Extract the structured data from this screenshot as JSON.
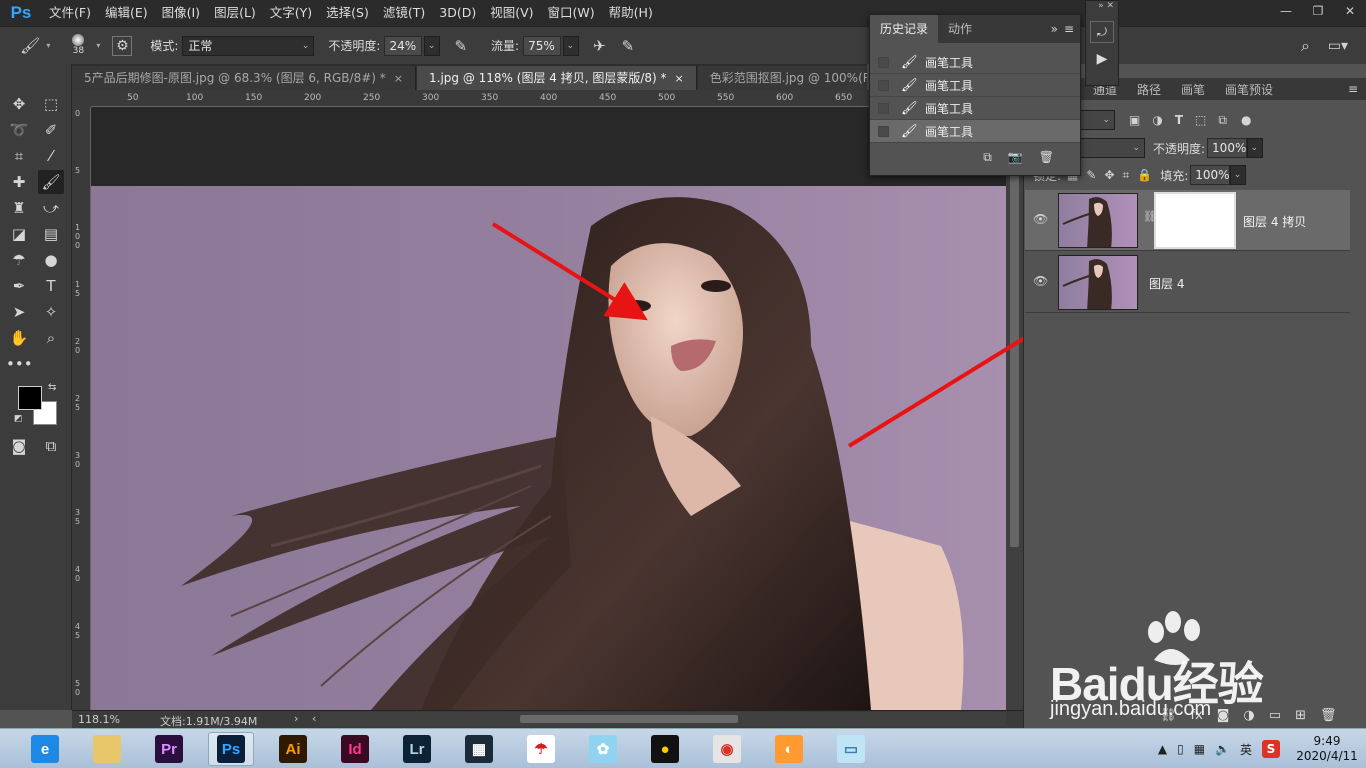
{
  "app": {
    "logo": "Ps"
  },
  "menu": {
    "items": [
      "文件(F)",
      "编辑(E)",
      "图像(I)",
      "图层(L)",
      "文字(Y)",
      "选择(S)",
      "滤镜(T)",
      "3D(D)",
      "视图(V)",
      "窗口(W)",
      "帮助(H)"
    ]
  },
  "options": {
    "brush_size": "38",
    "mode_label": "模式:",
    "mode_value": "正常",
    "opacity_label": "不透明度:",
    "opacity_value": "24%",
    "flow_label": "流量:",
    "flow_value": "75%"
  },
  "tabs": [
    {
      "label": "5产品后期修图-原图.jpg @ 68.3% (图层 6, RGB/8#) *",
      "close": "×"
    },
    {
      "label": "1.jpg @ 118% (图层 4 拷贝, 图层蒙版/8) *",
      "close": "×"
    },
    {
      "label": "色彩范围抠图.jpg @ 100%(RGB/8#)",
      "close": "×"
    }
  ],
  "ruler": {
    "top": [
      "50",
      "100",
      "150",
      "200",
      "250",
      "300",
      "350",
      "400",
      "450",
      "500",
      "550",
      "600",
      "650"
    ],
    "left": [
      "0",
      "5",
      "1 0 0",
      "1 5",
      "2 0",
      "2 5",
      "3 0",
      "3 5",
      "4 0",
      "4 5",
      "5 0"
    ]
  },
  "status": {
    "zoom": "118.1%",
    "doc": "文档:1.91M/3.94M"
  },
  "history": {
    "tabs": [
      "历史记录",
      "动作"
    ],
    "items": [
      "画笔工具",
      "画笔工具",
      "画笔工具",
      "画笔工具"
    ]
  },
  "layers_panel": {
    "tabs": [
      "通道",
      "路径",
      "画笔",
      "画笔预设"
    ],
    "opacity_label": "不透明度:",
    "opacity_value": "100%",
    "fill_label": "填充:",
    "fill_value": "100%",
    "lock_label": "锁定:",
    "layers": [
      {
        "name": "图层 4 拷贝",
        "selected": true
      },
      {
        "name": "图层 4",
        "selected": false
      }
    ]
  },
  "taskbar": {
    "apps": [
      {
        "name": "ie",
        "label": "e",
        "bg": "#1e88e5",
        "fg": "#ffffff"
      },
      {
        "name": "explorer",
        "label": "",
        "bg": "#e8c66a",
        "fg": "#ffffff"
      },
      {
        "name": "premiere",
        "label": "Pr",
        "bg": "#2a0f3e",
        "fg": "#e28dff"
      },
      {
        "name": "photoshop",
        "label": "Ps",
        "bg": "#0a1f3a",
        "fg": "#31a8ff"
      },
      {
        "name": "illustrator",
        "label": "Ai",
        "bg": "#2e1a00",
        "fg": "#ff9a00"
      },
      {
        "name": "indesign",
        "label": "Id",
        "bg": "#3a0a22",
        "fg": "#ff3690"
      },
      {
        "name": "lightroom",
        "label": "Lr",
        "bg": "#0d2232",
        "fg": "#add5ec"
      },
      {
        "name": "video",
        "label": "▦",
        "bg": "#1b2a3a",
        "fg": "#ffffff"
      },
      {
        "name": "umbrella",
        "label": "☂",
        "bg": "#ffffff",
        "fg": "#d02020"
      },
      {
        "name": "bird",
        "label": "✿",
        "bg": "#8fd3f0",
        "fg": "#ffffff"
      },
      {
        "name": "qq",
        "label": "●",
        "bg": "#111111",
        "fg": "#ffcc00"
      },
      {
        "name": "chrome",
        "label": "◉",
        "bg": "#e5e5e5",
        "fg": "#d93025"
      },
      {
        "name": "fox",
        "label": "◐",
        "bg": "#ff9a30",
        "fg": "#ffffff"
      },
      {
        "name": "notes",
        "label": "▭",
        "bg": "#bfe4f5",
        "fg": "#3a7fb0"
      }
    ],
    "ime": "英",
    "time": "9:49",
    "date": "2020/4/11"
  },
  "watermark": {
    "brand": "Baidu经验",
    "url": "jingyan.baidu.com"
  }
}
